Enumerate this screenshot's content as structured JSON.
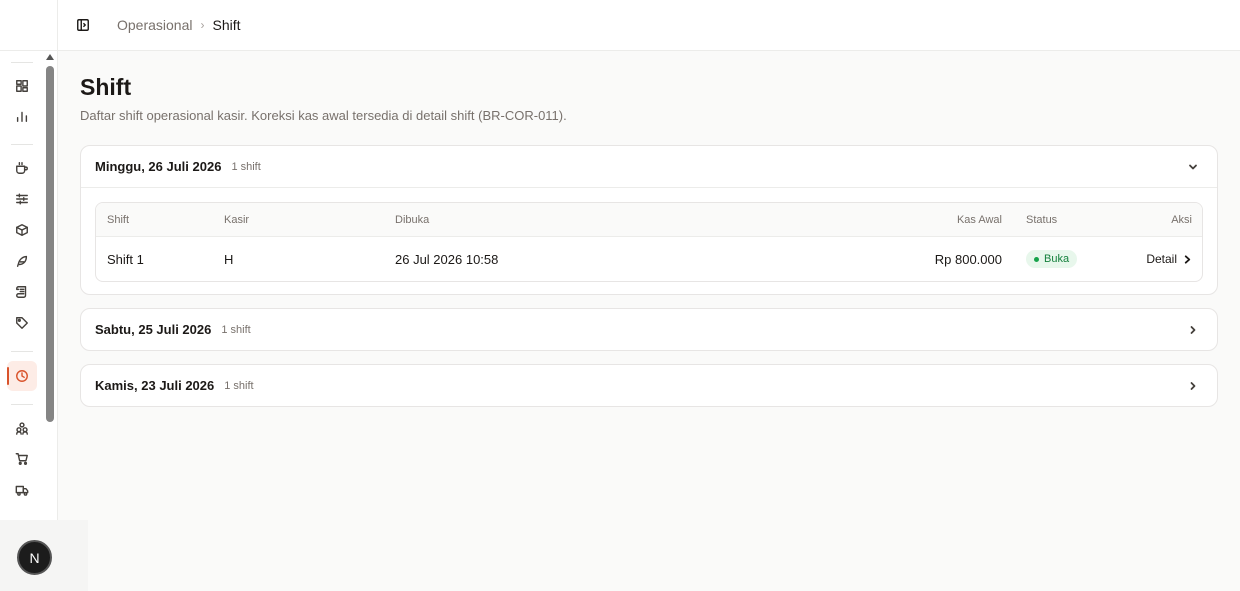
{
  "breadcrumb": {
    "parent": "Operasional",
    "current": "Shift"
  },
  "page": {
    "title": "Shift",
    "description": "Daftar shift operasional kasir. Koreksi kas awal tersedia di detail shift (BR-COR-011)."
  },
  "table_headers": {
    "shift": "Shift",
    "kasir": "Kasir",
    "dibuka": "Dibuka",
    "kas_awal": "Kas Awal",
    "status": "Status",
    "aksi": "Aksi"
  },
  "days": [
    {
      "date": "Minggu, 26 Juli 2026",
      "count": "1 shift",
      "expanded": true,
      "rows": [
        {
          "shift": "Shift 1",
          "kasir": "H",
          "dibuka": "26 Jul 2026 10:58",
          "kas_awal": "Rp 800.000",
          "status": "Buka",
          "aksi": "Detail"
        }
      ]
    },
    {
      "date": "Sabtu, 25 Juli 2026",
      "count": "1 shift",
      "expanded": false
    },
    {
      "date": "Kamis, 23 Juli 2026",
      "count": "1 shift",
      "expanded": false
    }
  ],
  "avatar": {
    "initial": "N"
  },
  "colors": {
    "accent": "#d9532b",
    "status_open_bg": "#e8f7ec",
    "status_open_text": "#15803d"
  },
  "sidebar_icons": [
    "dashboard-icon",
    "chart-icon",
    "coffee-icon",
    "sliders-icon",
    "box-icon",
    "feather-icon",
    "scroll-icon",
    "tag-icon",
    "clock-icon",
    "users-icon",
    "cart-icon",
    "truck-icon"
  ]
}
